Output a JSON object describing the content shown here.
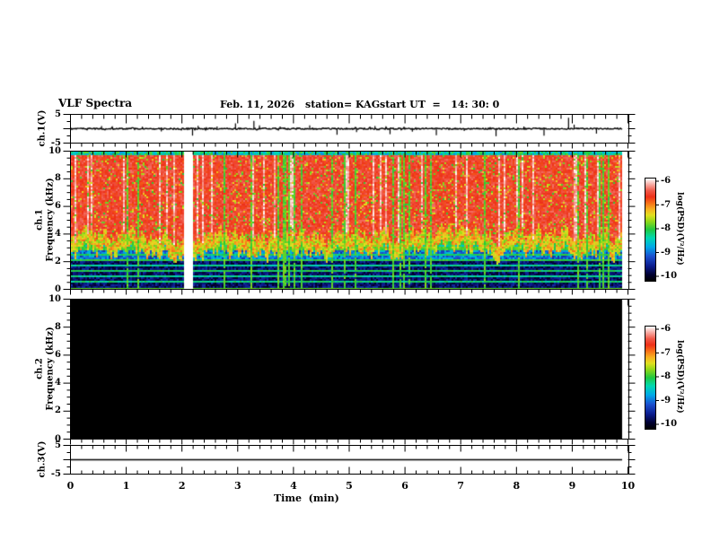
{
  "header": {
    "title": "VLF Spectra",
    "date": "Feb. 11, 2026",
    "station": "station= KAG",
    "start_ut": "start UT  =   14: 30: 0"
  },
  "panels": {
    "ch1_wave": {
      "ylabel": "ch.1(V)",
      "yticks": [
        "5",
        "-5"
      ]
    },
    "ch1_spec": {
      "ylabel_channel": "ch.1",
      "ylabel_axis": "Frequency (kHz)",
      "yticks": [
        "10",
        "8",
        "6",
        "4",
        "2",
        "0"
      ]
    },
    "ch2_spec": {
      "ylabel_channel": "ch.2",
      "ylabel_axis": "Frequency (kHz)",
      "yticks": [
        "10",
        "8",
        "6",
        "4",
        "2",
        "0"
      ]
    },
    "ch3_wave": {
      "ylabel": "ch.3(V)",
      "yticks": [
        "5",
        "-5"
      ]
    }
  },
  "xaxis": {
    "label": "Time  (min)",
    "ticks": [
      "0",
      "1",
      "2",
      "3",
      "4",
      "5",
      "6",
      "7",
      "8",
      "9",
      "10"
    ]
  },
  "colorbars": [
    {
      "label": "log(PSD)(V²/Hz)",
      "ticks": [
        "-6",
        "-7",
        "-8",
        "-9",
        "-10"
      ]
    },
    {
      "label": "log(PSD)(V²/Hz)",
      "ticks": [
        "-6",
        "-7",
        "-8",
        "-9",
        "-10"
      ]
    }
  ],
  "palette": {
    "stops": [
      {
        "pos": 0.0,
        "color": "#000000"
      },
      {
        "pos": 0.06,
        "color": "#000030"
      },
      {
        "pos": 0.14,
        "color": "#0a1a8a"
      },
      {
        "pos": 0.24,
        "color": "#1b50d0"
      },
      {
        "pos": 0.33,
        "color": "#00a8e8"
      },
      {
        "pos": 0.42,
        "color": "#00d8b0"
      },
      {
        "pos": 0.5,
        "color": "#20c840"
      },
      {
        "pos": 0.58,
        "color": "#90d818"
      },
      {
        "pos": 0.64,
        "color": "#e0e020"
      },
      {
        "pos": 0.7,
        "color": "#f8b020"
      },
      {
        "pos": 0.76,
        "color": "#f87018"
      },
      {
        "pos": 0.82,
        "color": "#ee3018"
      },
      {
        "pos": 0.88,
        "color": "#f05848"
      },
      {
        "pos": 0.94,
        "color": "#f8a8a0"
      },
      {
        "pos": 1.0,
        "color": "#ffffff"
      }
    ]
  },
  "chart_data": [
    {
      "id": "ch1_waveform",
      "type": "line",
      "channel": "ch.1(V)",
      "xlim": [
        0,
        10
      ],
      "ylim": [
        -5,
        5
      ],
      "baseline_v": 0,
      "noise_amp_v": 0.25,
      "data_end_min": 9.88,
      "spikes": [
        {
          "t": 0.55,
          "a": 0.9
        },
        {
          "t": 1.28,
          "a": 0.7
        },
        {
          "t": 1.62,
          "a": -0.9
        },
        {
          "t": 2.18,
          "a": -2.4
        },
        {
          "t": 2.28,
          "a": 1.0
        },
        {
          "t": 2.62,
          "a": 0.8
        },
        {
          "t": 2.95,
          "a": 1.9
        },
        {
          "t": 3.28,
          "a": 2.7
        },
        {
          "t": 3.38,
          "a": 1.2
        },
        {
          "t": 3.75,
          "a": 0.8
        },
        {
          "t": 4.28,
          "a": 1.2
        },
        {
          "t": 4.77,
          "a": -2.1
        },
        {
          "t": 5.12,
          "a": -1.2
        },
        {
          "t": 5.45,
          "a": 0.9
        },
        {
          "t": 5.72,
          "a": -1.9
        },
        {
          "t": 6.12,
          "a": -1.0
        },
        {
          "t": 6.55,
          "a": -2.3
        },
        {
          "t": 7.05,
          "a": -0.8
        },
        {
          "t": 7.62,
          "a": -2.6
        },
        {
          "t": 8.12,
          "a": 0.8
        },
        {
          "t": 8.48,
          "a": -2.4
        },
        {
          "t": 8.92,
          "a": 3.8
        },
        {
          "t": 9.02,
          "a": 1.4
        },
        {
          "t": 9.42,
          "a": -1.7
        }
      ]
    },
    {
      "id": "ch1_spectrogram",
      "type": "heatmap",
      "channel": "ch.1",
      "xlim": [
        0,
        10
      ],
      "ylim": [
        0,
        10
      ],
      "ylabel": "Frequency (kHz)",
      "zlabel": "log(PSD)(V²/Hz)",
      "zlim": [
        -10,
        -6
      ],
      "data_end_min": 9.88,
      "data_gap_min": [
        2.03,
        2.17
      ],
      "bands": [
        {
          "freq_khz": [
            5.5,
            10.0
          ],
          "level_log_psd": -6.6,
          "desc": "saturated broadband (red/white) with vertical sferic striations"
        },
        {
          "freq_khz": [
            4.2,
            5.5
          ],
          "level_log_psd": -7.4,
          "desc": "yellow/orange transition band"
        },
        {
          "freq_khz": [
            3.0,
            4.2
          ],
          "level_log_psd": -8.2,
          "desc": "green/cyan speckle"
        },
        {
          "freq_khz": [
            2.2,
            3.0
          ],
          "level_log_psd": -8.9,
          "desc": "blue speckle"
        },
        {
          "freq_khz": [
            0.0,
            2.2
          ],
          "level_log_psd": -9.7,
          "desc": "dark blue/black background"
        }
      ],
      "horizontal_lines_khz": [
        0.1,
        0.55,
        0.95,
        1.35,
        1.75,
        2.15,
        2.55,
        3.0,
        3.4
      ],
      "vertical_impulses": "frequent full-height broadband impulse lines (green) and saturated white columns"
    },
    {
      "id": "ch2_spectrogram",
      "type": "heatmap",
      "channel": "ch.2",
      "xlim": [
        0,
        10
      ],
      "ylim": [
        0,
        10
      ],
      "ylabel": "Frequency (kHz)",
      "zlabel": "log(PSD)(V²/Hz)",
      "zlim": [
        -10,
        -6
      ],
      "data_end_min": 9.88,
      "uniform_level_log_psd": -10
    },
    {
      "id": "ch3_waveform",
      "type": "line",
      "channel": "ch.3(V)",
      "xlim": [
        0,
        10
      ],
      "ylim": [
        -5,
        5
      ],
      "constant_value_v": 0,
      "data_end_min": 9.88
    }
  ]
}
